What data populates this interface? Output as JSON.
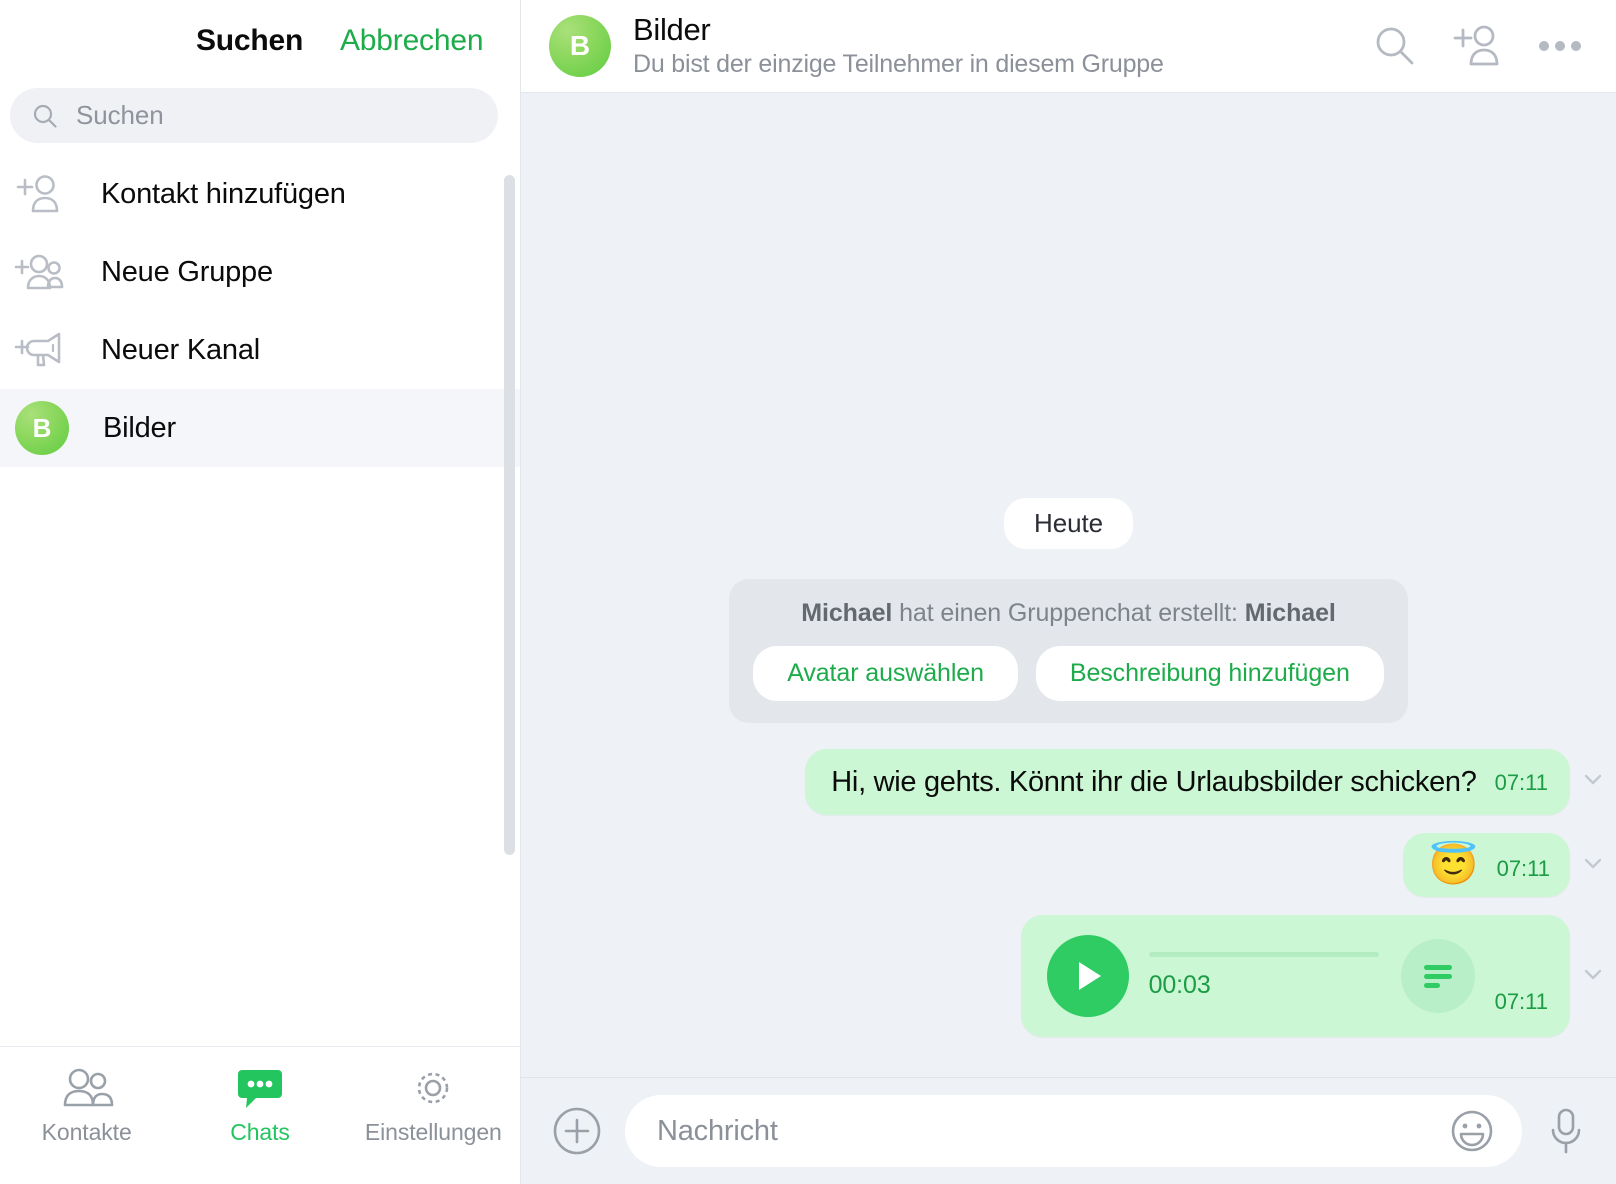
{
  "sidebar": {
    "header": {
      "title": "Suchen",
      "cancel_label": "Abbrechen"
    },
    "search": {
      "placeholder": "Suchen",
      "icon": "search-icon"
    },
    "items": [
      {
        "label": "Kontakt hinzufügen",
        "icon": "add-person-icon"
      },
      {
        "label": "Neue Gruppe",
        "icon": "add-group-icon"
      },
      {
        "label": "Neuer Kanal",
        "icon": "add-channel-icon"
      },
      {
        "label": "Bilder",
        "icon": "avatar",
        "avatar_initial": "B",
        "selected": true
      }
    ],
    "tabs": [
      {
        "label": "Kontakte",
        "icon": "contacts-icon",
        "active": false
      },
      {
        "label": "Chats",
        "icon": "chats-icon",
        "active": true
      },
      {
        "label": "Einstellungen",
        "icon": "gear-icon",
        "active": false
      }
    ]
  },
  "chat": {
    "header": {
      "avatar_initial": "B",
      "title": "Bilder",
      "subtitle": "Du bist der einzige Teilnehmer in diesem Gruppe",
      "icons": [
        "search-icon",
        "add-person-icon",
        "more-icon"
      ]
    },
    "date_chip": "Heute",
    "system_message": {
      "actor": "Michael",
      "middle_text": " hat einen Gruppenchat erstellt: ",
      "group_name": "Michael",
      "buttons": [
        {
          "label": "Avatar auswählen"
        },
        {
          "label": "Beschreibung hinzufügen"
        }
      ]
    },
    "messages": [
      {
        "type": "text",
        "text": "Hi, wie gehts. Könnt ihr die Urlaubsbilder schicken?",
        "time": "07:11"
      },
      {
        "type": "emoji",
        "emoji": "😇",
        "time": "07:11"
      },
      {
        "type": "voice",
        "duration": "00:03",
        "time": "07:11",
        "play_icon": "play-icon",
        "transcript_icon": "transcript-icon"
      }
    ],
    "composer": {
      "plus_icon": "plus-circle-icon",
      "placeholder": "Nachricht",
      "smiley_icon": "smiley-icon",
      "mic_icon": "microphone-icon"
    }
  },
  "colors": {
    "accent_green": "#1eac4b",
    "bubble_green": "#ccf7d4",
    "chat_bg": "#eef1f5",
    "muted_gray": "#8b9099"
  }
}
